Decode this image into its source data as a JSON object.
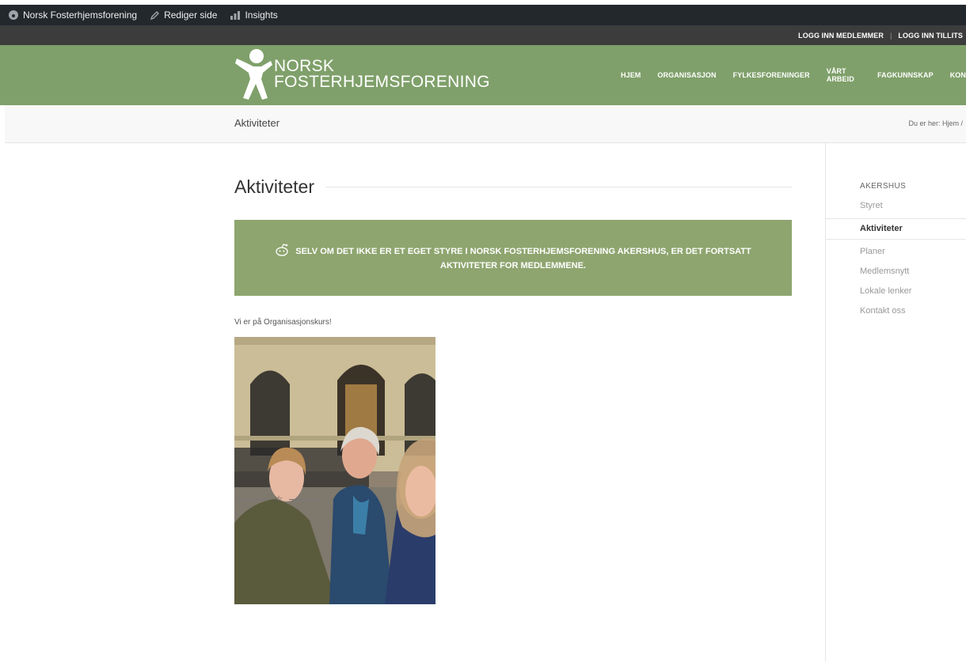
{
  "adminbar": {
    "site_name": "Norsk Fosterhjemsforening",
    "edit_label": "Rediger side",
    "insights_label": "Insights"
  },
  "topbar": {
    "login_members": "LOGG INN MEDLEMMER",
    "login_trusted": "LOGG INN TILLITS"
  },
  "logo": {
    "line1": "NORSK",
    "line2": "FOSTERHJEMSFORENING"
  },
  "nav": [
    "HJEM",
    "ORGANISASJON",
    "FYLKESFORENINGER",
    "VÅRT ARBEID",
    "FAGKUNNSKAP",
    "KON"
  ],
  "crumbbar": {
    "page_title": "Aktiviteter",
    "breadcrumb": "Du er her:  Hjem  /"
  },
  "main": {
    "heading": "Aktiviteter",
    "banner_text": "SELV OM DET IKKE ER ET EGET STYRE I NORSK FOSTERHJEMSFORENING AKERSHUS, ER DET FORTSATT AKTIVITETER FOR MEDLEMMENE.",
    "intro_text": "Vi er på Organisasjonskurs!",
    "divider_symbol": "☆"
  },
  "sidebar": {
    "title": "AKERSHUS",
    "items": [
      "Styret",
      "Aktiviteter",
      "Planer",
      "Medlemsnytt",
      "Lokale lenker",
      "Kontakt oss"
    ],
    "active_index": 1
  },
  "colors": {
    "adminbar": "#23282d",
    "header_green": "#7fa06a",
    "banner_green": "#8ea56f"
  }
}
